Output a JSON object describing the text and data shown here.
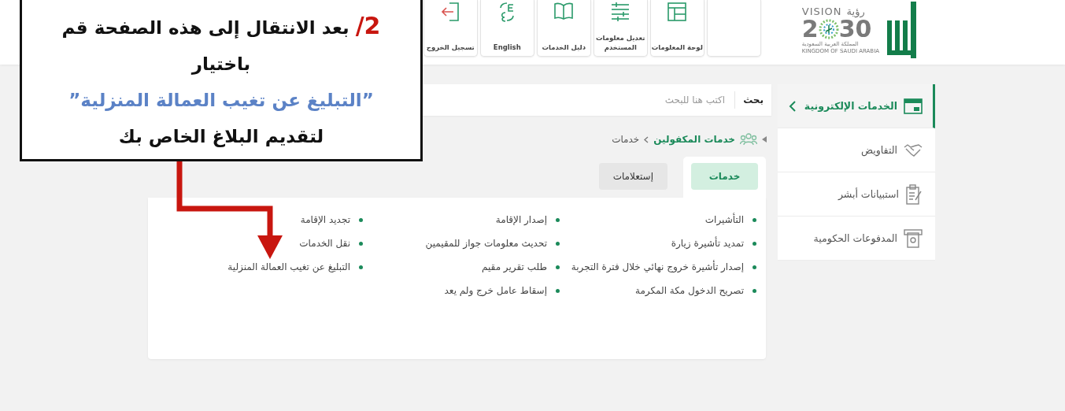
{
  "header": {
    "vision_logo": {
      "latin_word": "VISION",
      "arabic_word": "رؤية",
      "year_start": "2",
      "year_end": "30",
      "country_arabic": "المملكة العربية السعودية",
      "country_english": "KINGDOM OF SAUDI ARABIA"
    },
    "nav_tiles": [
      {
        "kind": "blank"
      },
      {
        "kind": "dashboard",
        "label": "لوحة المعلومات"
      },
      {
        "kind": "edit_profile",
        "label": "تعديل معلومات المستخدم"
      },
      {
        "kind": "guide",
        "label": "دليل الخدمات"
      },
      {
        "kind": "language",
        "label": "English"
      },
      {
        "kind": "logout",
        "label": "تسجيل الخروج"
      }
    ]
  },
  "sidebar": {
    "items": [
      {
        "kind": "eservices",
        "label": "الخدمات الإلكترونية",
        "selected": true
      },
      {
        "kind": "handshake",
        "label": "التفاويض",
        "selected": false
      },
      {
        "kind": "survey",
        "label": "استبيانات أبشر",
        "selected": false
      },
      {
        "kind": "payments",
        "label": "المدفوعات الحكومية",
        "selected": false
      }
    ]
  },
  "search": {
    "label": "بحث",
    "placeholder": "اكتب هنا للبحث"
  },
  "breadcrumb": [
    "خدمات المكفولين",
    "خدمات"
  ],
  "tabs": [
    {
      "label": "خدمات",
      "selected": true
    },
    {
      "label": "إستعلامات",
      "selected": false
    }
  ],
  "service_columns": [
    [
      "التأشيرات",
      "تمديد تأشيرة زيارة",
      "إصدار تأشيرة خروج نهائي خلال فترة التجربة",
      "تصريح الدخول مكة المكرمة"
    ],
    [
      "إصدار الإقامة",
      "تحديث معلومات جواز للمقيمين",
      "طلب تقرير مقيم",
      "إسقاط عامل خرج ولم يعد"
    ],
    [
      "تجديد الإقامة",
      "نقل الخدمات",
      "التبليغ عن تغيب العمالة المنزلية"
    ]
  ],
  "callout": {
    "step": "2/",
    "instruction": "بعد الانتقال إلى هذه الصفحة قم باختيار",
    "highlight": "”التبليغ عن تغيب العمالة المنزلية”",
    "closing": "لتقديم البلاغ الخاص بك"
  }
}
